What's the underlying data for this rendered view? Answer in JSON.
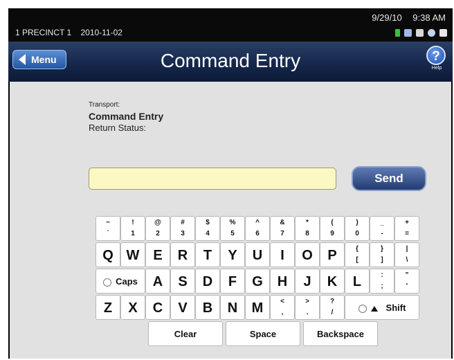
{
  "status": {
    "precinct": "1 PRECINCT 1",
    "date": "2010-11-02",
    "screen_date": "9/29/10",
    "time": "9:38 AM"
  },
  "header": {
    "menu_label": "Menu",
    "title": "Command Entry",
    "help_label": "Help"
  },
  "info": {
    "transport_label": "Transport:",
    "mode": "Command Entry",
    "return_status_label": "Return Status:"
  },
  "command": {
    "value": "",
    "send_label": "Send"
  },
  "keyboard": {
    "row1": [
      {
        "top": "~",
        "bot": "`"
      },
      {
        "top": "!",
        "bot": "1"
      },
      {
        "top": "@",
        "bot": "2"
      },
      {
        "top": "#",
        "bot": "3"
      },
      {
        "top": "$",
        "bot": "4"
      },
      {
        "top": "%",
        "bot": "5"
      },
      {
        "top": "^",
        "bot": "6"
      },
      {
        "top": "&",
        "bot": "7"
      },
      {
        "top": "*",
        "bot": "8"
      },
      {
        "top": "(",
        "bot": "9"
      },
      {
        "top": ")",
        "bot": "0"
      },
      {
        "top": "_",
        "bot": "-"
      },
      {
        "top": "+",
        "bot": "="
      }
    ],
    "row2_letters": [
      "Q",
      "W",
      "E",
      "R",
      "T",
      "Y",
      "U",
      "I",
      "O",
      "P"
    ],
    "row2_syms": [
      {
        "top": "{",
        "bot": "["
      },
      {
        "top": "}",
        "bot": "]"
      },
      {
        "top": "|",
        "bot": "\\"
      }
    ],
    "caps_label": "Caps",
    "row3_letters": [
      "A",
      "S",
      "D",
      "F",
      "G",
      "H",
      "J",
      "K",
      "L"
    ],
    "row3_syms": [
      {
        "top": ":",
        "bot": ";"
      },
      {
        "top": "\"",
        "bot": "'"
      }
    ],
    "row4_letters": [
      "Z",
      "X",
      "C",
      "V",
      "B",
      "N",
      "M"
    ],
    "row4_syms": [
      {
        "top": "<",
        "bot": ","
      },
      {
        "top": ">",
        "bot": "."
      },
      {
        "top": "?",
        "bot": "/"
      }
    ],
    "shift_label": "Shift",
    "clear_label": "Clear",
    "space_label": "Space",
    "backspace_label": "Backspace"
  },
  "colors": {
    "status_bg": "#0a0a0a",
    "titlebar": "#14264a",
    "menu_button": "#2356a3",
    "content_bg": "#e1e1e1",
    "input_bg": "#fbf8c4",
    "send_button": "#233c72"
  },
  "icons": [
    "battery-icon",
    "network-icon",
    "printer-icon",
    "headset-icon",
    "tray-icon"
  ]
}
